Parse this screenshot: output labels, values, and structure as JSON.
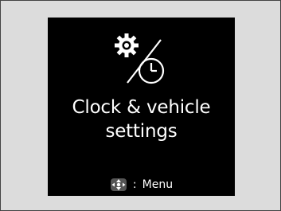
{
  "screen": {
    "title_line1": "Clock & vehicle",
    "title_line2": "settings",
    "hint_separator": ":",
    "hint_label": "Menu",
    "icons": [
      "gear-icon",
      "clock-icon",
      "selector-dial-icon"
    ],
    "colors": {
      "background": "#000000",
      "text": "#ffffff",
      "frame": "#dcdcdc"
    }
  }
}
